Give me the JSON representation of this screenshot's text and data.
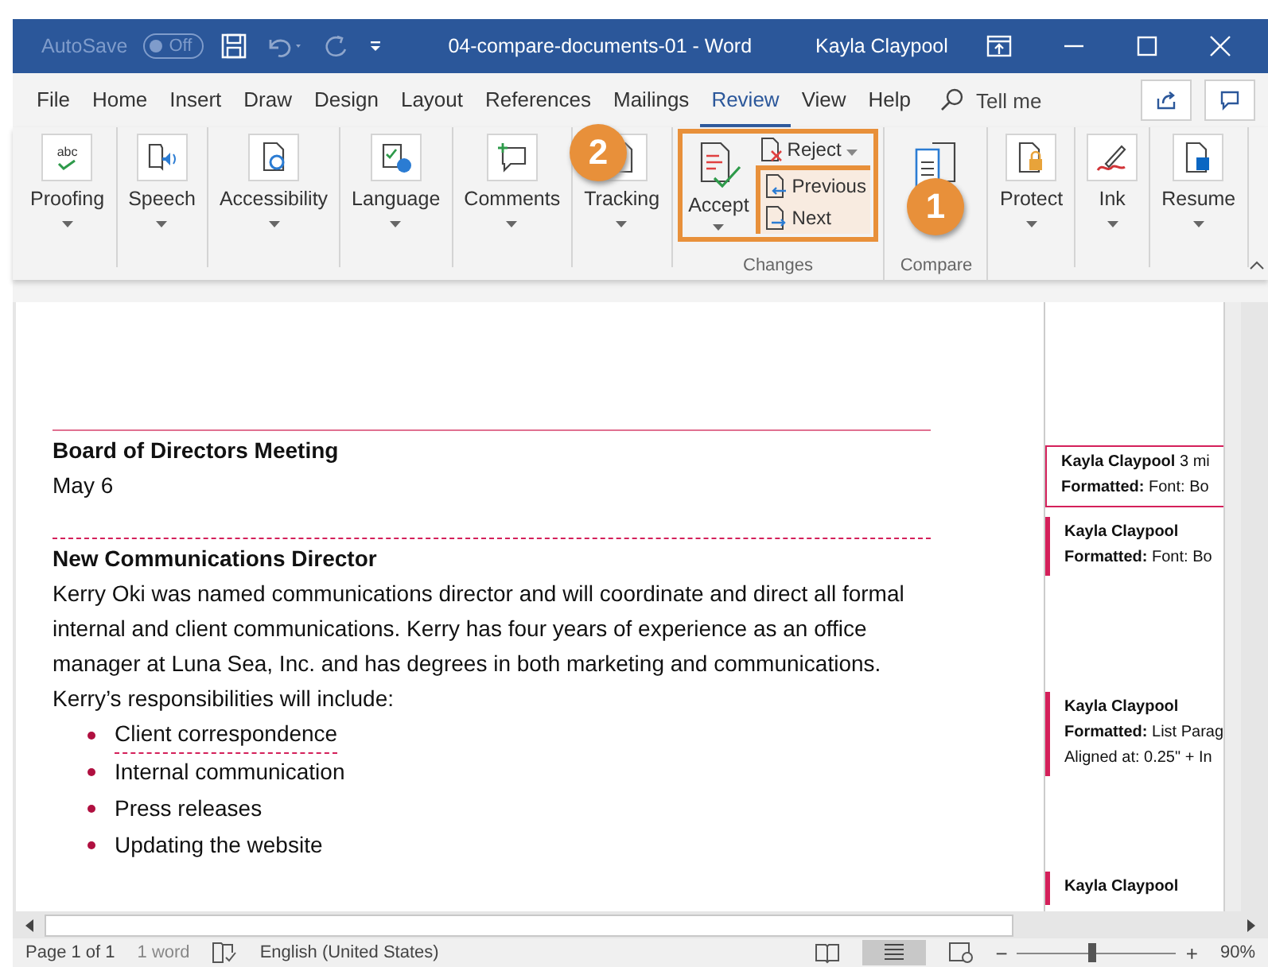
{
  "title_bar": {
    "autosave": "AutoSave",
    "autosave_toggle": {
      "label": "Off",
      "on": false
    },
    "title": "04-compare-documents-01 - Word",
    "user": "Kayla Claypool"
  },
  "tabs": [
    {
      "label": "File",
      "selected": false
    },
    {
      "label": "Home",
      "selected": false
    },
    {
      "label": "Insert",
      "selected": false
    },
    {
      "label": "Draw",
      "selected": false
    },
    {
      "label": "Design",
      "selected": false
    },
    {
      "label": "Layout",
      "selected": false
    },
    {
      "label": "References",
      "selected": false
    },
    {
      "label": "Mailings",
      "selected": false
    },
    {
      "label": "Review",
      "selected": true
    },
    {
      "label": "View",
      "selected": false
    },
    {
      "label": "Help",
      "selected": false
    }
  ],
  "tell_me": "Tell me",
  "ribbon": [
    {
      "kind": "button",
      "label": "Proofing",
      "icon_text": "abc"
    },
    {
      "kind": "button",
      "label": "Speech"
    },
    {
      "kind": "button",
      "label": "Accessibility"
    },
    {
      "kind": "button",
      "label": "Language"
    },
    {
      "kind": "button",
      "label": "Comments"
    },
    {
      "kind": "button",
      "label": "Tracking"
    },
    {
      "kind": "changes",
      "accept": "Accept",
      "reject": "Reject",
      "previous": "Previous",
      "next": "Next",
      "group_label": "Changes"
    },
    {
      "kind": "compare",
      "group_label": "Compare"
    },
    {
      "kind": "button",
      "label": "Protect"
    },
    {
      "kind": "button",
      "label": "Ink"
    },
    {
      "kind": "button",
      "label": "Resume"
    }
  ],
  "callouts": [
    {
      "label": "2"
    },
    {
      "label": "1"
    }
  ],
  "document": [
    {
      "kind": "heading",
      "text": "Board of Directors Meeting",
      "marked": true
    },
    {
      "kind": "para",
      "text": "May 6"
    },
    {
      "kind": "heading",
      "text": "New Communications Director",
      "marked": true
    },
    {
      "kind": "para",
      "text": "Kerry Oki was named communications director and will coordinate and direct all formal internal and client communications. Kerry has four years of experience as an office manager at Luna Sea, Inc. and has degrees in both marketing and communications. Kerry’s responsibilities will include:"
    },
    {
      "kind": "bullet",
      "text": "Client correspondence",
      "marked": true
    },
    {
      "kind": "bullet",
      "text": "Internal communication",
      "marked": false
    },
    {
      "kind": "bullet",
      "text": "Press releases",
      "marked": false
    },
    {
      "kind": "bullet",
      "text": "Updating the website",
      "marked": false
    }
  ],
  "comments": [
    {
      "author": "Kayla Claypool",
      "time": "3 mi",
      "lines": [
        "**Formatted:** Font: Bo"
      ],
      "selected": true
    },
    {
      "author": "Kayla Claypool",
      "lines": [
        "**Formatted:** Font: Bo"
      ],
      "selected": false
    },
    {
      "author": "Kayla Claypool",
      "lines": [
        "**Formatted:** List Parag",
        "Aligned at:  0.25\" + In"
      ],
      "selected": false
    },
    {
      "author": "Kayla Claypool",
      "selected": false
    }
  ],
  "status_bar": {
    "page": "Page 1 of 1",
    "words": "1 word",
    "language": "English (United States)",
    "zoom": {
      "out": "−",
      "level": 0.48,
      "in": "+",
      "label": "90%"
    }
  }
}
